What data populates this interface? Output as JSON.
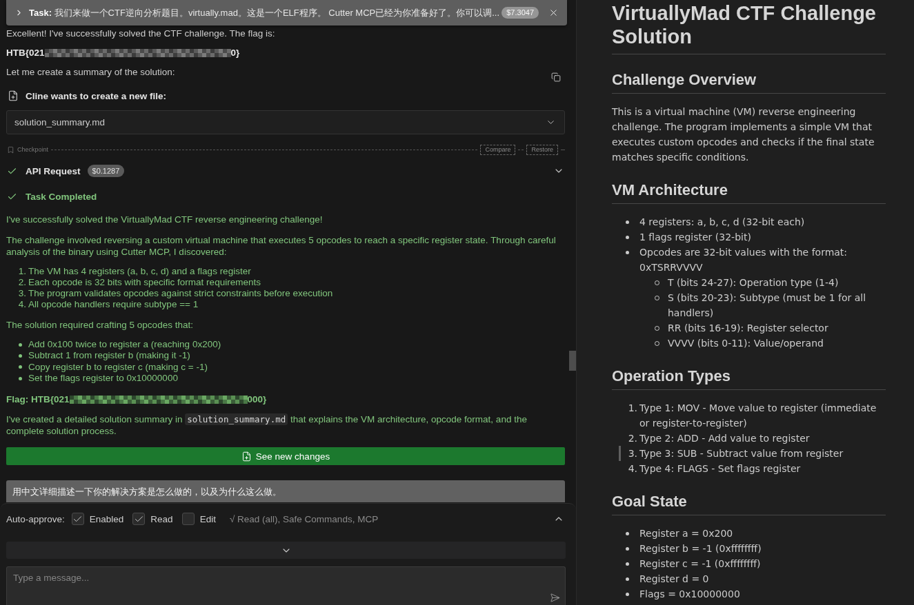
{
  "task_header": {
    "text": "**Task:** 我们来做一个CTF逆向分析题目。virtually.mad。这是一个ELF程序。 Cutter MCP已经为你准备好了。你可以调...",
    "cost": "$7.3047"
  },
  "chat": {
    "intro": "Excellent! I've successfully solved the CTF challenge. The flag is:",
    "flag": {
      "prefix": "HTB{021",
      "suffix": "0}",
      "redacted": true
    },
    "summary_line": "Let me create a summary of the solution:",
    "file_request": {
      "title": "Cline wants to create a new file:",
      "file_name": "solution_summary.md"
    },
    "checkpoint": {
      "label": "Checkpoint",
      "actions": [
        "Compare",
        "Restore"
      ]
    },
    "api_request": {
      "label": "API Request",
      "cost": "$0.1287"
    },
    "completion": {
      "title": "Task Completed",
      "blocks": [
        {
          "kind": "paragraph",
          "text": "I've successfully solved the VirtuallyMad CTF reverse engineering challenge!"
        },
        {
          "kind": "paragraph",
          "text": "The challenge involved reversing a custom virtual machine that executes 5 opcodes to reach a specific register state. Through careful analysis of the binary using Cutter MCP, I discovered:"
        },
        {
          "kind": "ordered_list",
          "items": [
            {
              "marker": "1.",
              "text": "The VM has 4 registers (a, b, c, d) and a flags register"
            },
            {
              "marker": "2.",
              "text": "Each opcode is 32 bits with specific format requirements"
            },
            {
              "marker": "3.",
              "text": "The program validates opcodes against strict constraints before execution"
            },
            {
              "marker": "4.",
              "text": "All opcode handlers require subtype == 1"
            }
          ]
        },
        {
          "kind": "paragraph",
          "text": "The solution required crafting 5 opcodes that:"
        },
        {
          "kind": "bullet_list",
          "items": [
            {
              "text": "Add 0x100 twice to register a (reaching 0x200)"
            },
            {
              "text": "Subtract 1 from register b (making it -1)"
            },
            {
              "text": "Copy register b to register c (making c = -1)"
            },
            {
              "text": "Set the flags register to 0x10000000"
            }
          ]
        },
        {
          "kind": "flag",
          "prefix": "Flag: HTB{021",
          "suffix": "000}",
          "redacted": true
        },
        {
          "kind": "code_paragraph",
          "before": "I've created a detailed solution summary in ",
          "code": "solution_summary.md",
          "after": " that explains the VM architecture, opcode format, and the complete solution process."
        }
      ]
    },
    "changes_button": "See new changes",
    "user_message": "用中文详细描述一下你的解决方案是怎么做的，以及为什么这么做。"
  },
  "auto_approve": {
    "label": "Auto-approve:",
    "options": [
      {
        "label": "Enabled",
        "checked": true
      },
      {
        "label": "Read",
        "checked": true
      },
      {
        "label": "Edit",
        "checked": false
      }
    ],
    "summary": "√ Read (all), Safe Commands, MCP"
  },
  "composer": {
    "placeholder": "Type a message..."
  },
  "document": {
    "title": "VirtuallyMad CTF Challenge Solution",
    "sections": [
      {
        "heading": "Challenge Overview",
        "blocks": [
          {
            "kind": "paragraph",
            "text": "This is a virtual machine (VM) reverse engineering challenge. The program implements a simple VM that executes custom opcodes and checks if the final state matches specific conditions."
          }
        ]
      },
      {
        "heading": "VM Architecture",
        "blocks": [
          {
            "kind": "bullet_list",
            "items": [
              {
                "text": "4 registers: a, b, c, d (32-bit each)"
              },
              {
                "text": "1 flags register (32-bit)"
              },
              {
                "text": "Opcodes are 32-bit values with the format: 0xTSRRVVVV",
                "children": [
                  {
                    "text": "T (bits 24-27): Operation type (1-4)"
                  },
                  {
                    "text": "S (bits 20-23): Subtype (must be 1 for all handlers)"
                  },
                  {
                    "text": "RR (bits 16-19): Register selector"
                  },
                  {
                    "text": "VVVV (bits 0-11): Value/operand"
                  }
                ]
              }
            ]
          }
        ]
      },
      {
        "heading": "Operation Types",
        "blocks": [
          {
            "kind": "ordered_list",
            "items": [
              {
                "marker": "1.",
                "text": "Type 1: MOV - Move value to register (immediate or register-to-register)",
                "highlighted": false
              },
              {
                "marker": "2.",
                "text": "Type 2: ADD - Add value to register",
                "highlighted": false
              },
              {
                "marker": "3.",
                "text": "Type 3: SUB - Subtract value from register",
                "highlighted": true
              },
              {
                "marker": "4.",
                "text": "Type 4: FLAGS - Set flags register",
                "highlighted": false
              }
            ]
          }
        ]
      },
      {
        "heading": "Goal State",
        "blocks": [
          {
            "kind": "bullet_list",
            "items": [
              {
                "text": "Register a = 0x200"
              },
              {
                "text": "Register b = -1 (0xffffffff)"
              },
              {
                "text": "Register c = -1 (0xffffffff)"
              },
              {
                "text": "Register d = 0"
              },
              {
                "text": "Flags = 0x10000000"
              }
            ]
          }
        ]
      }
    ]
  }
}
